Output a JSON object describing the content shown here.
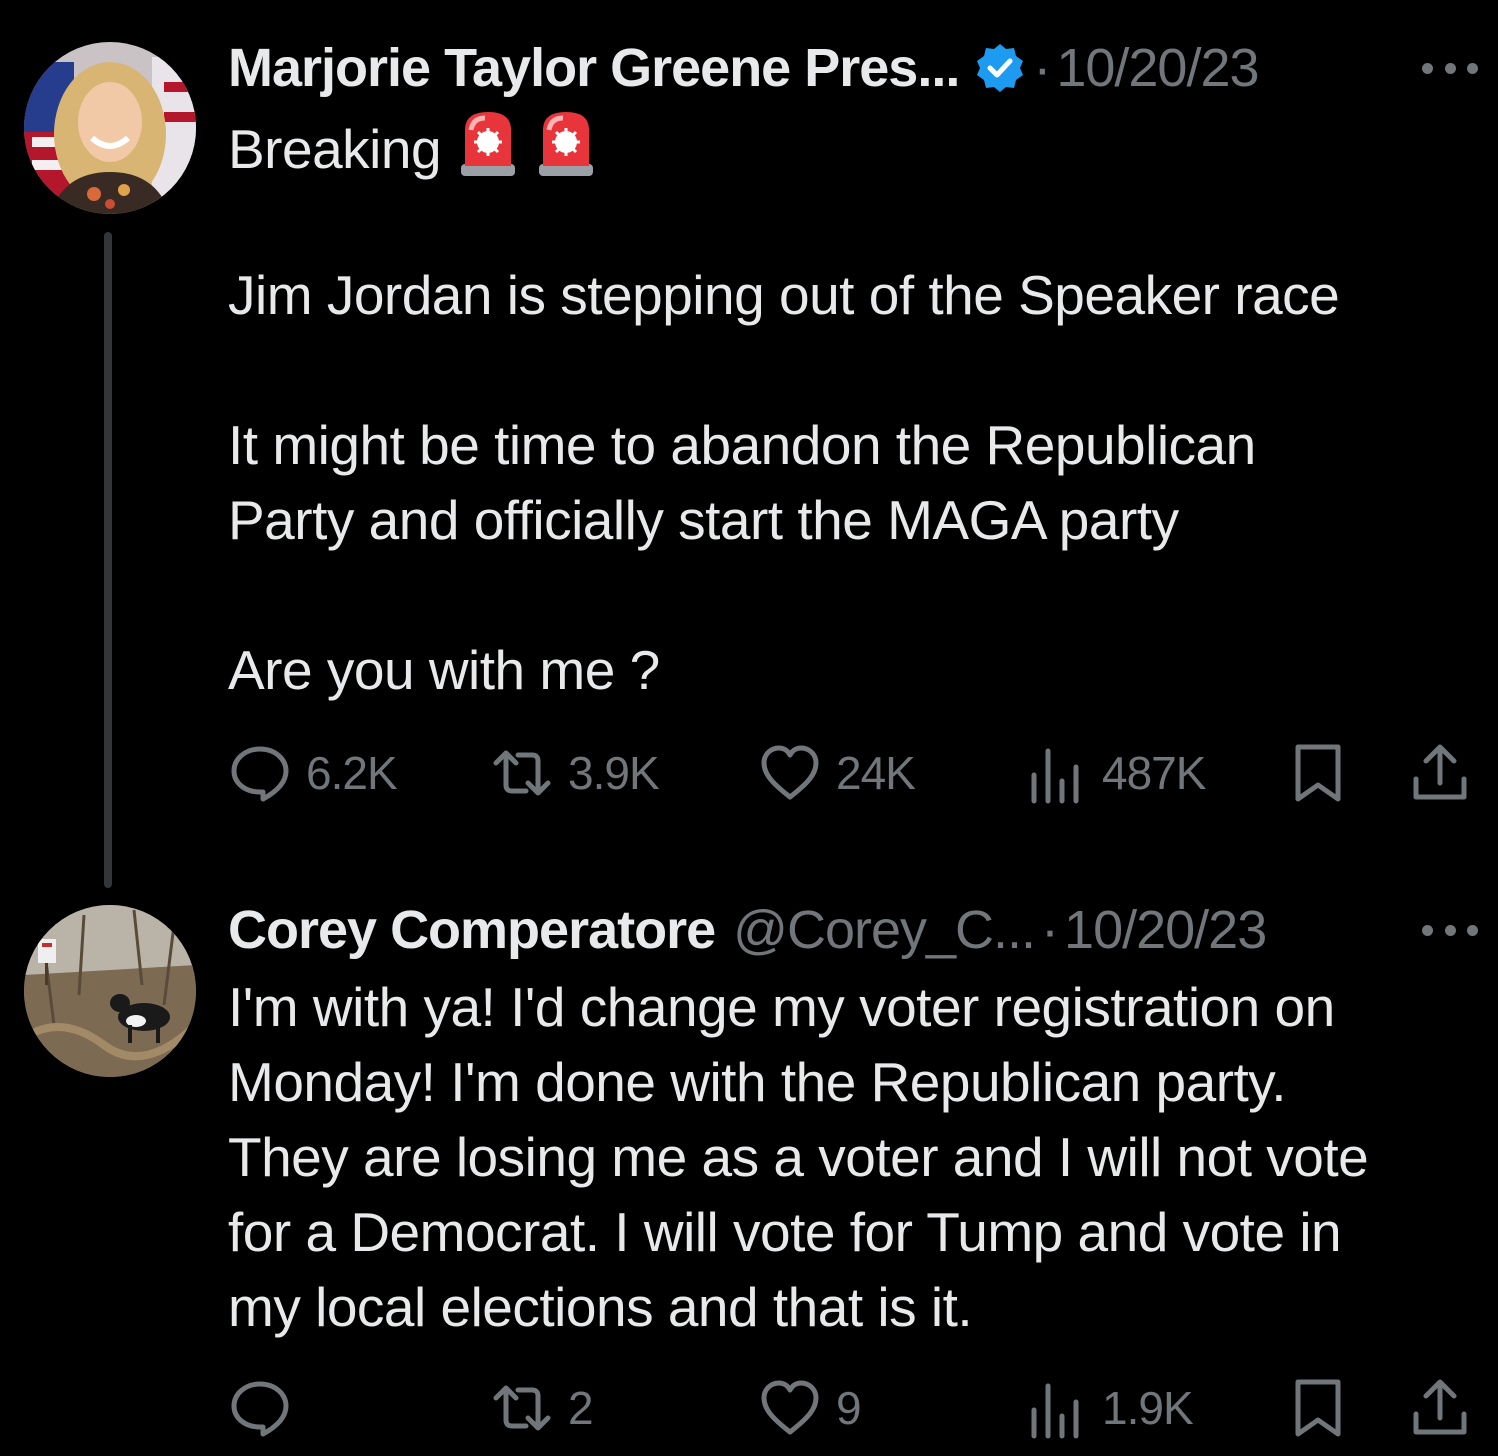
{
  "tweets": [
    {
      "display_name": "Marjorie Taylor Greene Pres...",
      "verified": true,
      "handle": "",
      "separator": "·",
      "date": "10/20/23",
      "lines": [
        "Breaking",
        "",
        "Jim Jordan is stepping out of the Speaker race",
        "",
        "It might be time to abandon the Republican",
        "Party and officially start the MAGA party",
        "",
        "Are you with me ?"
      ],
      "emoji": [
        "police-car-light",
        "police-car-light"
      ],
      "stats": {
        "replies": "6.2K",
        "retweets": "3.9K",
        "likes": "24K",
        "views": "487K"
      }
    },
    {
      "display_name": "Corey Comperatore",
      "verified": false,
      "handle": "@Corey_C...",
      "separator": "·",
      "date": "10/20/23",
      "lines": [
        "I'm with ya! I'd change my voter registration on",
        "Monday! I'm done with the Republican party.",
        "They are losing me as a voter and I will not vote",
        "for a Democrat. I will vote for Tump and vote in",
        "my local elections and that is it."
      ],
      "stats": {
        "replies": "",
        "retweets": "2",
        "likes": "9",
        "views": "1.9K"
      }
    }
  ],
  "icons": {
    "reply": "speech-bubble-icon",
    "retweet": "retweet-arrows-icon",
    "like": "heart-icon",
    "views": "bar-chart-icon",
    "bookmark": "bookmark-icon",
    "share": "share-upload-icon",
    "more": "more-dots-icon",
    "verified": "verified-badge-icon"
  },
  "colors": {
    "background": "#000000",
    "primary_text": "#e7e9ea",
    "secondary_text": "#71767b",
    "verified_blue": "#1d9bf0",
    "thread_line": "#333639"
  }
}
